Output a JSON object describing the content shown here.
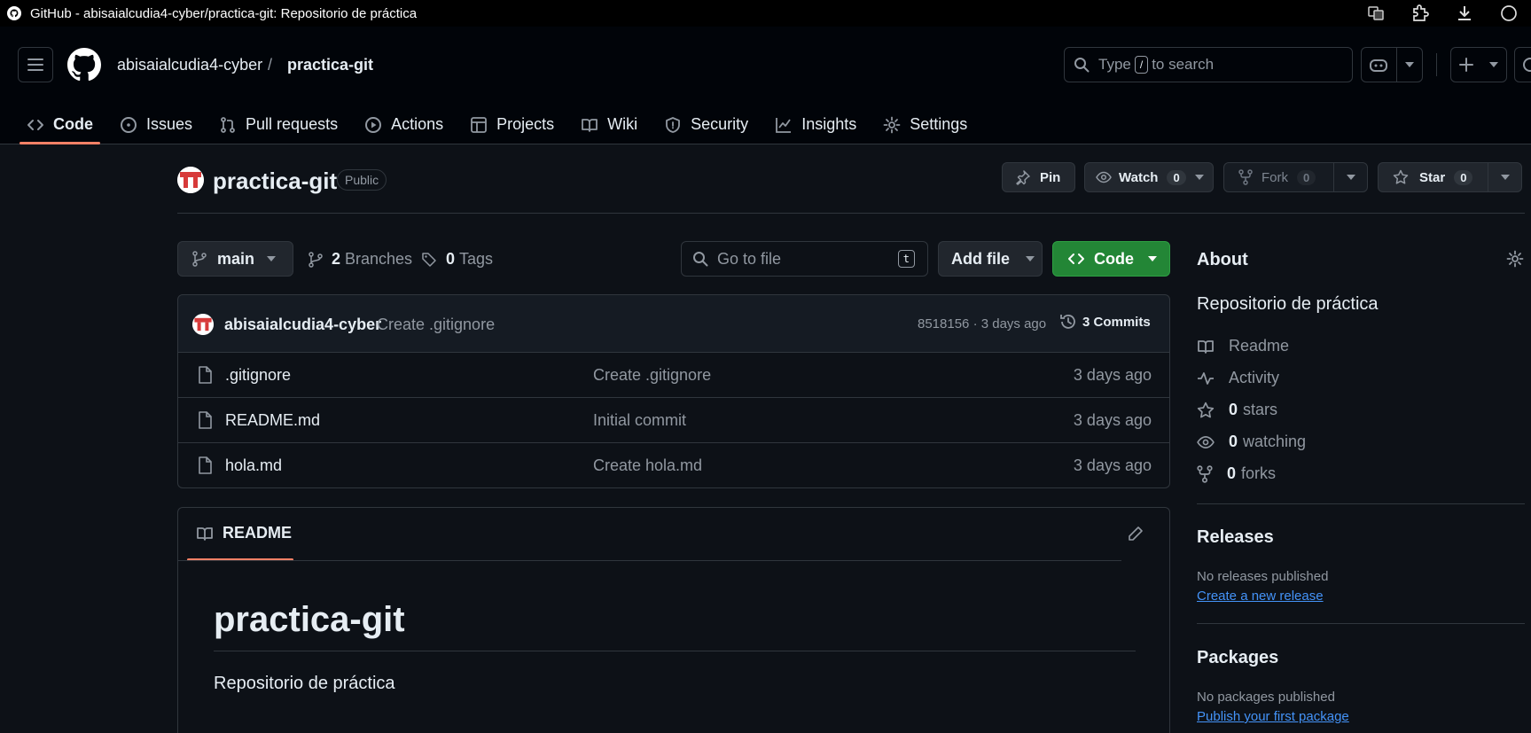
{
  "browser": {
    "tab_title": "GitHub - abisaialcudia4-cyber/practica-git: Repositorio de práctica"
  },
  "header": {
    "owner": "abisaialcudia4-cyber",
    "separator": "/",
    "repo": "practica-git",
    "search_prefix": "Type",
    "search_key": "/",
    "search_suffix": "to search"
  },
  "nav": [
    {
      "label": "Code",
      "icon": "code-icon",
      "active": true
    },
    {
      "label": "Issues",
      "icon": "issue-icon"
    },
    {
      "label": "Pull requests",
      "icon": "pull-request-icon"
    },
    {
      "label": "Actions",
      "icon": "play-icon"
    },
    {
      "label": "Projects",
      "icon": "table-icon"
    },
    {
      "label": "Wiki",
      "icon": "book-icon"
    },
    {
      "label": "Security",
      "icon": "shield-icon"
    },
    {
      "label": "Insights",
      "icon": "graph-icon"
    },
    {
      "label": "Settings",
      "icon": "gear-icon"
    }
  ],
  "repo": {
    "name": "practica-git",
    "visibility": "Public",
    "pin_label": "Pin",
    "watch_label": "Watch",
    "watch_count": "0",
    "fork_label": "Fork",
    "fork_count": "0",
    "star_label": "Star",
    "star_count": "0"
  },
  "toolbar": {
    "branch": "main",
    "branches_count": "2",
    "branches_label": "Branches",
    "tags_count": "0",
    "tags_label": "Tags",
    "goto_placeholder": "Go to file",
    "goto_key": "t",
    "add_file_label": "Add file",
    "code_label": "Code"
  },
  "latest_commit": {
    "author": "abisaialcudia4-cyber",
    "message": "Create .gitignore",
    "meta": "8518156 · 3 days ago",
    "commits_label": "3 Commits"
  },
  "files": [
    {
      "name": ".gitignore",
      "message": "Create .gitignore",
      "date": "3 days ago"
    },
    {
      "name": "README.md",
      "message": "Initial commit",
      "date": "3 days ago"
    },
    {
      "name": "hola.md",
      "message": "Create hola.md",
      "date": "3 days ago"
    }
  ],
  "readme": {
    "tab_label": "README",
    "heading": "practica-git",
    "body": "Repositorio de práctica"
  },
  "about": {
    "title": "About",
    "description": "Repositorio de práctica",
    "readme_label": "Readme",
    "activity_label": "Activity",
    "stars_count": "0",
    "stars_label": "stars",
    "watching_count": "0",
    "watching_label": "watching",
    "forks_count": "0",
    "forks_label": "forks"
  },
  "releases": {
    "title": "Releases",
    "empty": "No releases published",
    "link": "Create a new release"
  },
  "packages": {
    "title": "Packages",
    "empty": "No packages published",
    "link": "Publish your first package"
  },
  "colors": {
    "background": "#0d1117",
    "accent_green": "#238636",
    "link_blue": "#4493f8",
    "active_underline": "#f78166"
  }
}
